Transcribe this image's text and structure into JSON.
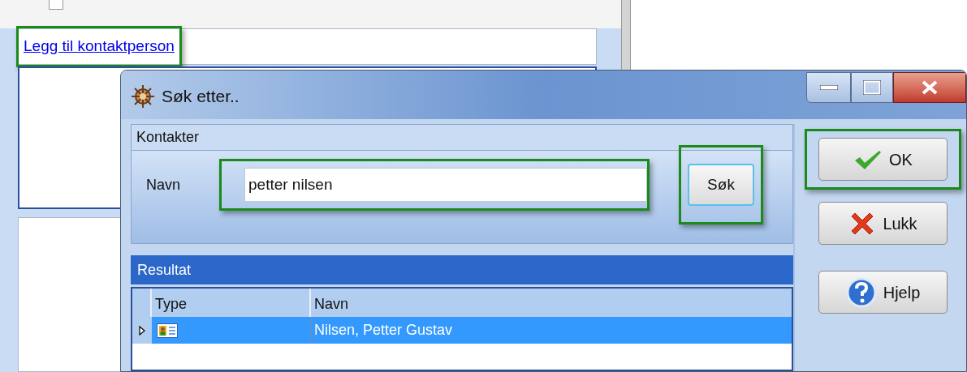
{
  "background_form": {
    "checkbox_checked": false,
    "link": "Legg til kontaktperson",
    "highlighted": true
  },
  "dialog": {
    "title": "Søk etter..",
    "contacts_group": {
      "title": "Kontakter",
      "name_label": "Navn",
      "name_value": "petter nilsen",
      "name_highlighted": true,
      "search_button": "Søk",
      "search_highlighted": true
    },
    "results": {
      "title": "Resultat",
      "columns": [
        "Type",
        "Navn"
      ],
      "rows": [
        {
          "kind": "contact",
          "name": "Nilsen, Petter Gustav",
          "selected": true
        }
      ]
    },
    "buttons": [
      {
        "kind": "ok",
        "label": "OK",
        "highlighted": true
      },
      {
        "kind": "close",
        "label": "Lukk",
        "highlighted": false
      },
      {
        "kind": "help",
        "label": "Hjelp",
        "highlighted": false
      }
    ]
  }
}
